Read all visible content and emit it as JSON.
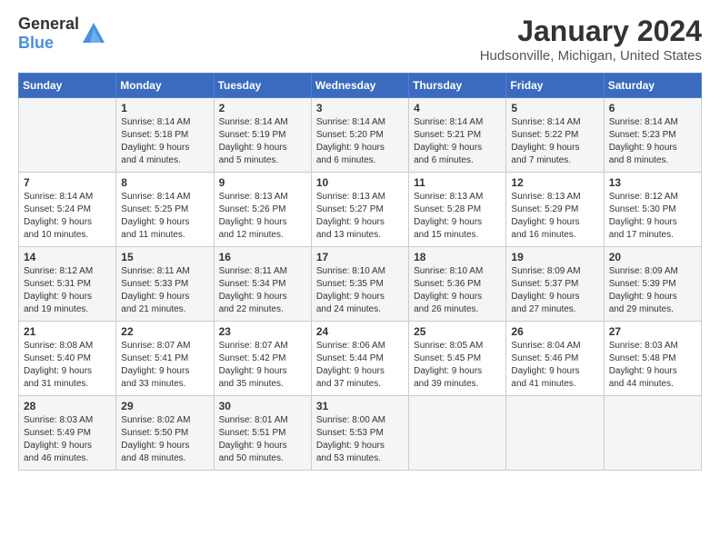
{
  "header": {
    "logo_general": "General",
    "logo_blue": "Blue",
    "month": "January 2024",
    "location": "Hudsonville, Michigan, United States"
  },
  "days_of_week": [
    "Sunday",
    "Monday",
    "Tuesday",
    "Wednesday",
    "Thursday",
    "Friday",
    "Saturday"
  ],
  "weeks": [
    [
      {
        "day": "",
        "info": ""
      },
      {
        "day": "1",
        "info": "Sunrise: 8:14 AM\nSunset: 5:18 PM\nDaylight: 9 hours\nand 4 minutes."
      },
      {
        "day": "2",
        "info": "Sunrise: 8:14 AM\nSunset: 5:19 PM\nDaylight: 9 hours\nand 5 minutes."
      },
      {
        "day": "3",
        "info": "Sunrise: 8:14 AM\nSunset: 5:20 PM\nDaylight: 9 hours\nand 6 minutes."
      },
      {
        "day": "4",
        "info": "Sunrise: 8:14 AM\nSunset: 5:21 PM\nDaylight: 9 hours\nand 6 minutes."
      },
      {
        "day": "5",
        "info": "Sunrise: 8:14 AM\nSunset: 5:22 PM\nDaylight: 9 hours\nand 7 minutes."
      },
      {
        "day": "6",
        "info": "Sunrise: 8:14 AM\nSunset: 5:23 PM\nDaylight: 9 hours\nand 8 minutes."
      }
    ],
    [
      {
        "day": "7",
        "info": "Sunrise: 8:14 AM\nSunset: 5:24 PM\nDaylight: 9 hours\nand 10 minutes."
      },
      {
        "day": "8",
        "info": "Sunrise: 8:14 AM\nSunset: 5:25 PM\nDaylight: 9 hours\nand 11 minutes."
      },
      {
        "day": "9",
        "info": "Sunrise: 8:13 AM\nSunset: 5:26 PM\nDaylight: 9 hours\nand 12 minutes."
      },
      {
        "day": "10",
        "info": "Sunrise: 8:13 AM\nSunset: 5:27 PM\nDaylight: 9 hours\nand 13 minutes."
      },
      {
        "day": "11",
        "info": "Sunrise: 8:13 AM\nSunset: 5:28 PM\nDaylight: 9 hours\nand 15 minutes."
      },
      {
        "day": "12",
        "info": "Sunrise: 8:13 AM\nSunset: 5:29 PM\nDaylight: 9 hours\nand 16 minutes."
      },
      {
        "day": "13",
        "info": "Sunrise: 8:12 AM\nSunset: 5:30 PM\nDaylight: 9 hours\nand 17 minutes."
      }
    ],
    [
      {
        "day": "14",
        "info": "Sunrise: 8:12 AM\nSunset: 5:31 PM\nDaylight: 9 hours\nand 19 minutes."
      },
      {
        "day": "15",
        "info": "Sunrise: 8:11 AM\nSunset: 5:33 PM\nDaylight: 9 hours\nand 21 minutes."
      },
      {
        "day": "16",
        "info": "Sunrise: 8:11 AM\nSunset: 5:34 PM\nDaylight: 9 hours\nand 22 minutes."
      },
      {
        "day": "17",
        "info": "Sunrise: 8:10 AM\nSunset: 5:35 PM\nDaylight: 9 hours\nand 24 minutes."
      },
      {
        "day": "18",
        "info": "Sunrise: 8:10 AM\nSunset: 5:36 PM\nDaylight: 9 hours\nand 26 minutes."
      },
      {
        "day": "19",
        "info": "Sunrise: 8:09 AM\nSunset: 5:37 PM\nDaylight: 9 hours\nand 27 minutes."
      },
      {
        "day": "20",
        "info": "Sunrise: 8:09 AM\nSunset: 5:39 PM\nDaylight: 9 hours\nand 29 minutes."
      }
    ],
    [
      {
        "day": "21",
        "info": "Sunrise: 8:08 AM\nSunset: 5:40 PM\nDaylight: 9 hours\nand 31 minutes."
      },
      {
        "day": "22",
        "info": "Sunrise: 8:07 AM\nSunset: 5:41 PM\nDaylight: 9 hours\nand 33 minutes."
      },
      {
        "day": "23",
        "info": "Sunrise: 8:07 AM\nSunset: 5:42 PM\nDaylight: 9 hours\nand 35 minutes."
      },
      {
        "day": "24",
        "info": "Sunrise: 8:06 AM\nSunset: 5:44 PM\nDaylight: 9 hours\nand 37 minutes."
      },
      {
        "day": "25",
        "info": "Sunrise: 8:05 AM\nSunset: 5:45 PM\nDaylight: 9 hours\nand 39 minutes."
      },
      {
        "day": "26",
        "info": "Sunrise: 8:04 AM\nSunset: 5:46 PM\nDaylight: 9 hours\nand 41 minutes."
      },
      {
        "day": "27",
        "info": "Sunrise: 8:03 AM\nSunset: 5:48 PM\nDaylight: 9 hours\nand 44 minutes."
      }
    ],
    [
      {
        "day": "28",
        "info": "Sunrise: 8:03 AM\nSunset: 5:49 PM\nDaylight: 9 hours\nand 46 minutes."
      },
      {
        "day": "29",
        "info": "Sunrise: 8:02 AM\nSunset: 5:50 PM\nDaylight: 9 hours\nand 48 minutes."
      },
      {
        "day": "30",
        "info": "Sunrise: 8:01 AM\nSunset: 5:51 PM\nDaylight: 9 hours\nand 50 minutes."
      },
      {
        "day": "31",
        "info": "Sunrise: 8:00 AM\nSunset: 5:53 PM\nDaylight: 9 hours\nand 53 minutes."
      },
      {
        "day": "",
        "info": ""
      },
      {
        "day": "",
        "info": ""
      },
      {
        "day": "",
        "info": ""
      }
    ]
  ]
}
